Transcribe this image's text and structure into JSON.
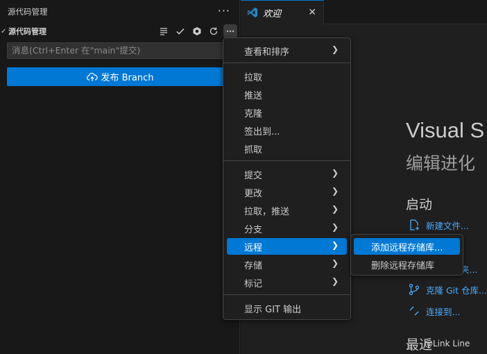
{
  "sidebar": {
    "title": "源代码管理",
    "more": "···",
    "repo_name": "源代码管理",
    "commit_placeholder": "消息(Ctrl+Enter 在\"main\"提交)",
    "publish_label": "发布 Branch"
  },
  "tab": {
    "label": "欢迎",
    "close": "✕"
  },
  "welcome": {
    "title": "Visual S",
    "subtitle": "编辑进化",
    "start_heading": "启动",
    "links": [
      {
        "label": "新建文件..."
      },
      {
        "label": "..."
      },
      {
        "label": "夹..."
      },
      {
        "label": "克隆 Git 仓库..."
      },
      {
        "label": "连接到..."
      }
    ],
    "recent_heading": "最近"
  },
  "menu": {
    "items": [
      {
        "label": "查看和排序",
        "submenu": true
      },
      {
        "label": "拉取"
      },
      {
        "label": "推送"
      },
      {
        "label": "克隆"
      },
      {
        "label": "签出到..."
      },
      {
        "label": "抓取"
      },
      {
        "label": "提交",
        "submenu": true
      },
      {
        "label": "更改",
        "submenu": true
      },
      {
        "label": "拉取，推送",
        "submenu": true
      },
      {
        "label": "分支",
        "submenu": true
      },
      {
        "label": "远程",
        "submenu": true,
        "selected": true
      },
      {
        "label": "存储",
        "submenu": true
      },
      {
        "label": "标记",
        "submenu": true
      },
      {
        "label": "显示 GIT 输出"
      }
    ]
  },
  "submenu": {
    "items": [
      {
        "label": "添加远程存储库...",
        "selected": true
      },
      {
        "label": "删除远程存储库"
      }
    ]
  },
  "watermark": "@Link Line",
  "colors": {
    "accent": "#0078d4",
    "link": "#4daafc",
    "menu_bg": "#1f1f1f",
    "panel_bg": "#181818"
  }
}
